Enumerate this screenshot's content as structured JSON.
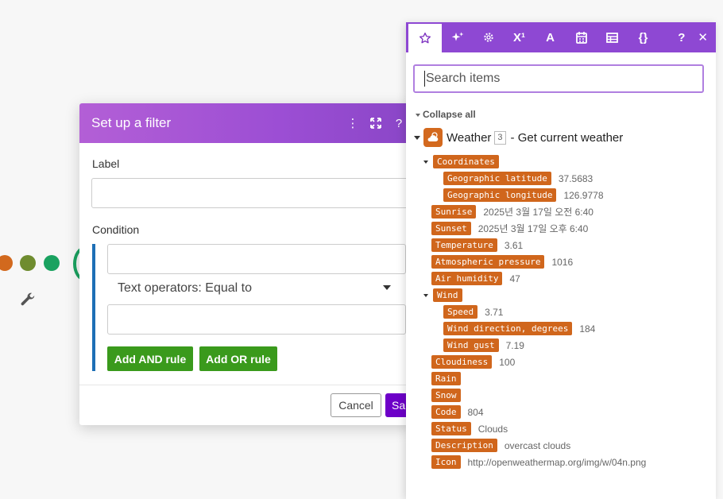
{
  "colors": {
    "accent_purple": "#8e48d3",
    "pill_orange": "#d0661c",
    "add_rule_green": "#3a9a1c",
    "save_purple": "#6d00c8",
    "condition_bar_blue": "#1d6fb6"
  },
  "filter_dialog": {
    "title": "Set up a filter",
    "label_field_label": "Label",
    "label_value": "",
    "condition_label": "Condition",
    "operand1_value": "",
    "operator_value": "Text operators: Equal to",
    "operand2_value": "",
    "add_and_rule": "Add AND rule",
    "add_or_rule": "Add OR rule",
    "cancel": "Cancel",
    "save": "Sa"
  },
  "mapping_panel": {
    "tabs": [
      "star-icon",
      "sparkle-icon",
      "gear-icon",
      "superscript-icon",
      "text-icon",
      "calendar-icon",
      "table-icon",
      "braces-icon"
    ],
    "help_label": "?",
    "close_label": "✕",
    "search_placeholder": "Search items",
    "collapse_all": "Collapse all",
    "module": {
      "name": "Weather",
      "count": "3",
      "action": "- Get current weather"
    },
    "items": {
      "coordinates": "Coordinates",
      "latitude": {
        "label": "Geographic latitude",
        "value": "37.5683"
      },
      "longitude": {
        "label": "Geographic longitude",
        "value": "126.9778"
      },
      "sunrise": {
        "label": "Sunrise",
        "value": "2025년 3월 17일 오전 6:40"
      },
      "sunset": {
        "label": "Sunset",
        "value": "2025년 3월 17일 오후 6:40"
      },
      "temperature": {
        "label": "Temperature",
        "value": "3.61"
      },
      "pressure": {
        "label": "Atmospheric pressure",
        "value": "1016"
      },
      "humidity": {
        "label": "Air humidity",
        "value": "47"
      },
      "wind": "Wind",
      "speed": {
        "label": "Speed",
        "value": "3.71"
      },
      "direction": {
        "label": "Wind direction, degrees",
        "value": "184"
      },
      "gust": {
        "label": "Wind gust",
        "value": "7.19"
      },
      "cloudiness": {
        "label": "Cloudiness",
        "value": "100"
      },
      "rain": {
        "label": "Rain"
      },
      "snow": {
        "label": "Snow"
      },
      "code": {
        "label": "Code",
        "value": "804"
      },
      "status": {
        "label": "Status",
        "value": "Clouds"
      },
      "description": {
        "label": "Description",
        "value": "overcast clouds"
      },
      "icon": {
        "label": "Icon",
        "value": "http://openweathermap.org/img/w/04n.png"
      }
    }
  }
}
